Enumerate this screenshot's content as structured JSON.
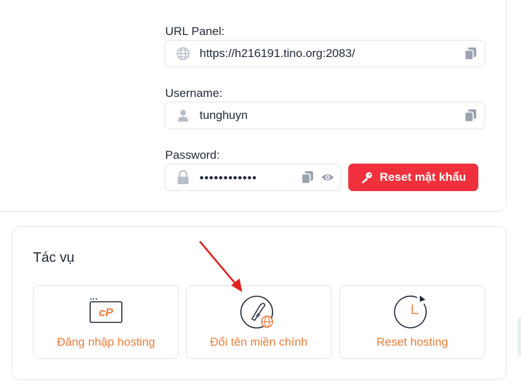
{
  "credentials": {
    "url_label": "URL Panel:",
    "url_value": "https://h216191.tino.org:2083/",
    "username_label": "Username:",
    "username_value": "tunghuyn",
    "password_label": "Password:",
    "password_value": "••••••••••••",
    "reset_password_label": "Reset mật khẩu"
  },
  "tasks": {
    "title": "Tác vụ",
    "items": [
      {
        "label": "Đăng nhập hosting",
        "icon": "cpanel-icon"
      },
      {
        "label": "Đổi tên miền chính",
        "icon": "rocket-globe-icon"
      },
      {
        "label": "Reset hosting",
        "icon": "reset-clock-icon"
      }
    ]
  },
  "colors": {
    "accent_orange": "#f07c38",
    "danger_red": "#f0303c",
    "icon_gray": "#9aa3af",
    "annotation_arrow": "#e0201c"
  }
}
